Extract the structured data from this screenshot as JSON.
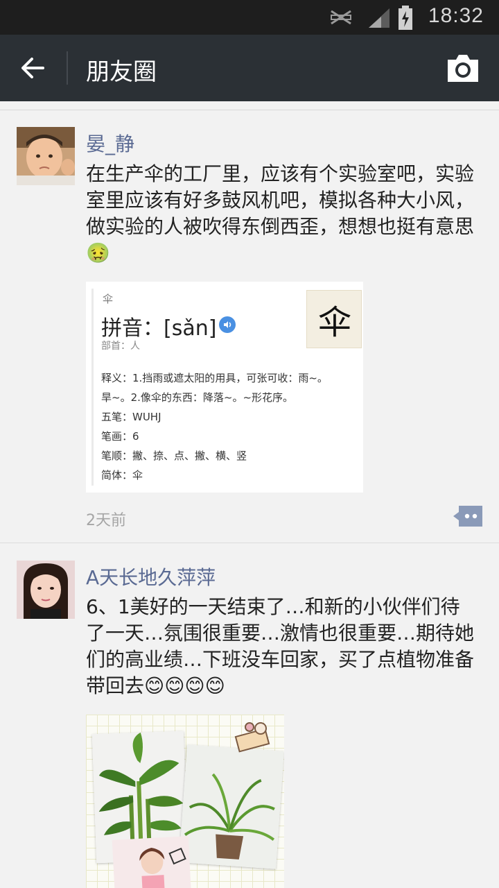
{
  "status_bar": {
    "time": "18:32",
    "icons": [
      "no-signal-icon",
      "signal-icon",
      "battery-charging-icon"
    ]
  },
  "header": {
    "title": "朋友圈",
    "back_icon": "arrow-left-icon",
    "camera_icon": "camera-icon"
  },
  "colors": {
    "header_bg": "#2b3035",
    "author_name": "#5a6a93",
    "comment_button": "#8a9ab8"
  },
  "posts": [
    {
      "author": "晏_静",
      "text": "在生产伞的工厂里，应该有个实验室吧，实验室里应该有好多鼓风机吧，模拟各种大小风，做实验的人被吹得东倒西歪，想想也挺有意思",
      "emoji": "🤢",
      "timestamp": "2天前",
      "image": {
        "small_char": "伞",
        "pinyin": "拼音：[sǎn]",
        "radical": "部首：人",
        "big_char": "伞",
        "lines": [
          "释义：1.挡雨或遮太阳的用具，可张可收：雨~。",
          "旱~。2.像伞的东西：降落~。~形花序。",
          "五笔：WUHJ",
          "笔画：6",
          "笔顺：撇、捺、点、撇、横、竖",
          "简体：伞"
        ]
      }
    },
    {
      "author": "A天长地久萍萍",
      "text": "6、1美好的一天结束了…和新的小伙伴们待了一天…氛围很重要…激情也很重要…期待她们的高业绩…下班没车回家，买了点植物准备带回去",
      "emoji": "😊😊😊😊"
    }
  ]
}
